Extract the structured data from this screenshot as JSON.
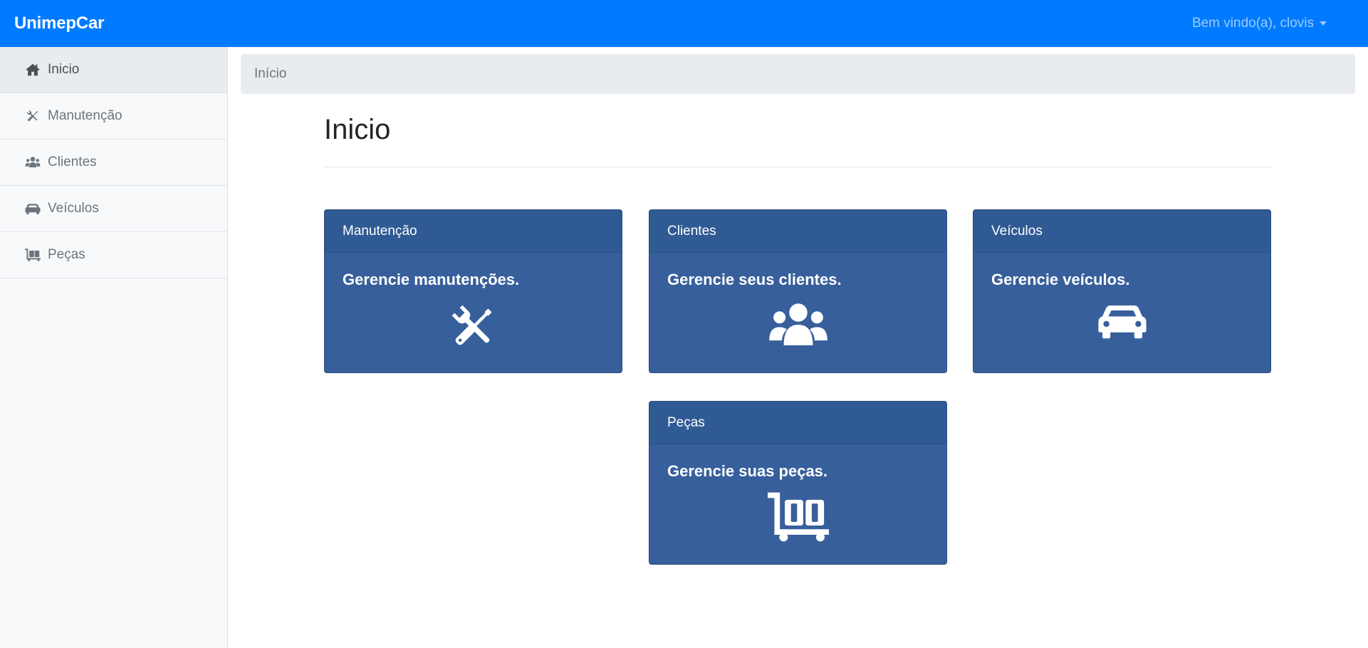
{
  "navbar": {
    "brand": "UnimepCar",
    "user_menu": "Bem vindo(a), clovis"
  },
  "sidebar": {
    "items": [
      {
        "label": "Inicio",
        "icon": "home-icon",
        "active": true
      },
      {
        "label": "Manutenção",
        "icon": "tools-icon",
        "active": false
      },
      {
        "label": "Clientes",
        "icon": "users-icon",
        "active": false
      },
      {
        "label": "Veículos",
        "icon": "car-icon",
        "active": false
      },
      {
        "label": "Peças",
        "icon": "dolly-cart-icon",
        "active": false
      }
    ]
  },
  "breadcrumb": {
    "current": "Início"
  },
  "main": {
    "title": "Inicio",
    "cards": [
      {
        "header": "Manutenção",
        "text": "Gerencie manutenções.",
        "icon": "tools-icon"
      },
      {
        "header": "Clientes",
        "text": "Gerencie seus clientes.",
        "icon": "users-icon"
      },
      {
        "header": "Veículos",
        "text": "Gerencie veículos.",
        "icon": "car-icon"
      },
      {
        "header": "Peças",
        "text": "Gerencie suas peças.",
        "icon": "dolly-cart-icon"
      }
    ]
  },
  "colors": {
    "navbar": "#007bff",
    "card": "#375f9b",
    "card_header": "#305a93",
    "sidebar": "#f8f9fa"
  }
}
